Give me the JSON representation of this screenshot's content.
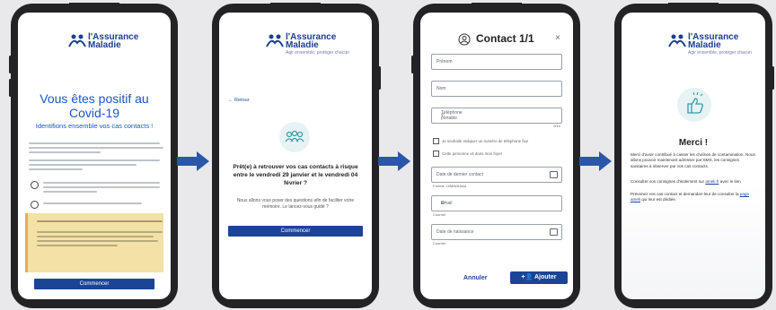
{
  "logo": {
    "line1": "l'Assurance",
    "line2": "Maladie",
    "tagline": "Agir ensemble, protéger chacun"
  },
  "screen1": {
    "title_line1": "Vous êtes positif au",
    "title_line2": "Covid-19",
    "subtitle": "Identifions ensemble vos cas contacts !",
    "button": "Commencer"
  },
  "screen2": {
    "back": "Retour",
    "heading": "Prêt(e) à retrouver vos cas contacts à risque entre le vendredi 29 janvier et le vendredi 04 février ?",
    "body": "Nous allons vous poser des questions afin de faciliter votre mémoire. Le lancez-vous guidé ?",
    "button": "Commencer"
  },
  "screen3": {
    "title": "Contact 1/1",
    "close": "×",
    "fields": {
      "first_name": "Prénom",
      "last_name": "Nom",
      "phone": "Téléphone portable",
      "checkbox1": "Je souhaite indiquer un numéro de téléphone fixe",
      "checkbox2": "Cette personne vit dans mon foyer",
      "date_contact": "Date de dernier contact",
      "date_contact_hint": "Format JJ/MM/AAAA",
      "email": "Email",
      "email_hint": "Courriel",
      "birth_date": "Date de naissance",
      "birth_date_hint": "Courriel"
    },
    "cancel": "Annuler",
    "add": "Ajouter"
  },
  "screen4": {
    "title": "Merci !",
    "p1": "Merci d'avoir contribué à casser les chaînes de contamination. Nous allons pouvoir maintenant adresser par SMS, les consignes sanitaires à observer par vos cas contacts.",
    "p2_pre": "Consulter vos consignes d'isolement sur",
    "p2_link": "ameli.fr",
    "p2_post": "avec le lien",
    "p3_pre": "Prévenez vos cas contact et demandez-leur de consulter la",
    "p3_link": "page ameli",
    "p3_post": "qui leur est dédiée."
  },
  "colors": {
    "navy": "#1c4496",
    "title_blue": "#1a56c4",
    "arrow": "#2c56a8",
    "gold": "#f3e2a6"
  }
}
